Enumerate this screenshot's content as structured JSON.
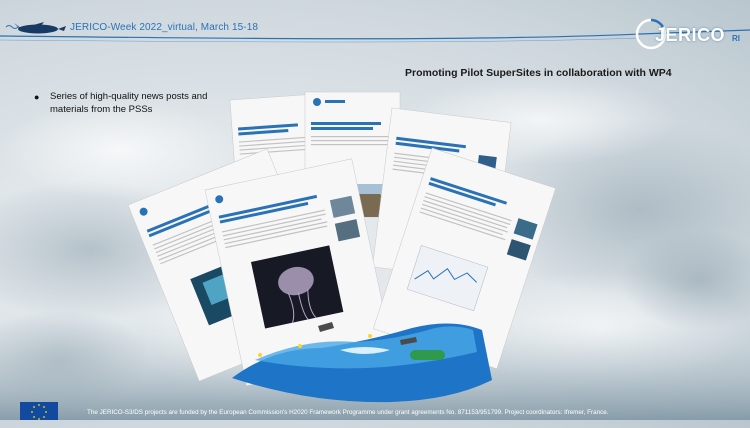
{
  "header": {
    "event_title": "JERICO-Week 2022_virtual, March 15-18",
    "logo_text": "JERICO",
    "logo_suffix": "RI"
  },
  "slide": {
    "title": "Promoting Pilot SuperSites in collaboration with WP4",
    "bullets": [
      "Series of high-quality news posts and materials from the PSSs"
    ]
  },
  "footer": {
    "funding_text": "The JERICO-S3/DS projects are funded by the European Commission's H2020 Framework Programme under grant agreements No. 871153/951799. Project coordinators: Ifremer, France."
  },
  "colors": {
    "brand_blue": "#2a72b6",
    "eu_blue": "#114a9e",
    "eu_star": "#ffdd00",
    "wave_blue": "#1e74c7",
    "wave_light": "#48a8e6"
  }
}
